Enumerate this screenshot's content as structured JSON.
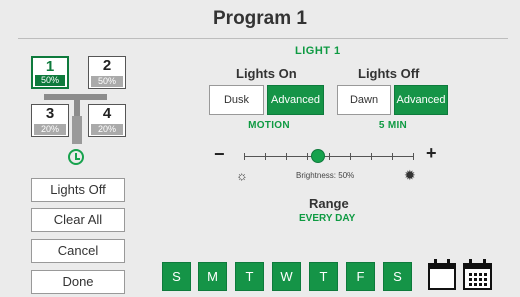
{
  "title": "Program 1",
  "tiles": [
    {
      "num": "1",
      "pct": "50%"
    },
    {
      "num": "2",
      "pct": "50%"
    },
    {
      "num": "3",
      "pct": "20%"
    },
    {
      "num": "4",
      "pct": "20%"
    }
  ],
  "side_buttons": {
    "lights_off": "Lights Off",
    "clear_all": "Clear All",
    "cancel": "Cancel",
    "done": "Done"
  },
  "light_header": "LIGHT 1",
  "lights_on": {
    "title": "Lights On",
    "option_a": "Dusk",
    "option_b": "Advanced",
    "mode": "MOTION"
  },
  "lights_off": {
    "title": "Lights Off",
    "option_a": "Dawn",
    "option_b": "Advanced",
    "mode": "5 MIN"
  },
  "brightness": {
    "minus": "−",
    "plus": "+",
    "label": "Brightness: 50%",
    "value_percent": 50
  },
  "range": {
    "title": "Range",
    "value": "EVERY DAY"
  },
  "days": [
    "S",
    "M",
    "T",
    "W",
    "T",
    "F",
    "S"
  ],
  "icons": {
    "timer": "clock-icon",
    "brightness_low": "sun-dim-icon",
    "brightness_high": "sun-bright-icon",
    "single_calendar": "calendar-icon",
    "grid_calendar": "calendar-grid-icon"
  },
  "colors": {
    "accent": "#159447",
    "accent_text": "#0e9a42",
    "background": "#ebebeb"
  }
}
